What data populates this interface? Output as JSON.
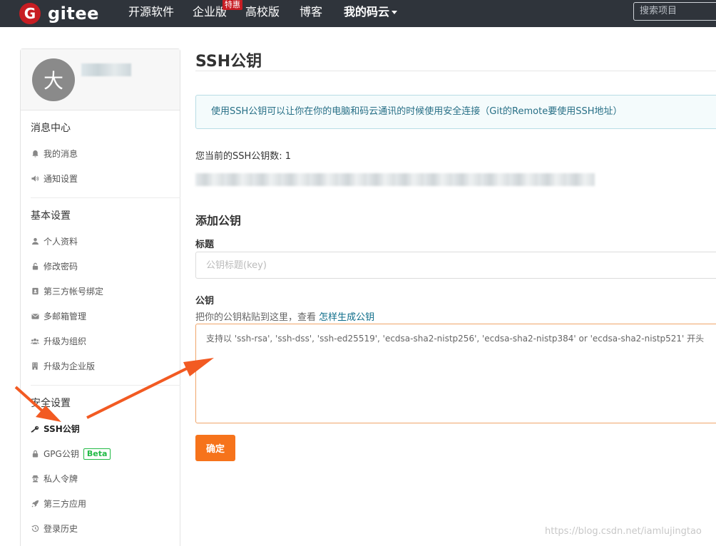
{
  "topnav": {
    "logo_mark": "G",
    "logo_text": "gitee",
    "items": [
      "开源软件",
      "企业版",
      "高校版",
      "博客",
      "我的码云"
    ],
    "hot_badge": "特惠",
    "search_placeholder": "搜索项目"
  },
  "sidebar": {
    "avatar_initial": "大",
    "sections": [
      {
        "title": "消息中心",
        "items": [
          "我的消息",
          "通知设置"
        ]
      },
      {
        "title": "基本设置",
        "items": [
          "个人资料",
          "修改密码",
          "第三方帐号绑定",
          "多邮箱管理",
          "升级为组织",
          "升级为企业版"
        ]
      },
      {
        "title": "安全设置",
        "items": [
          "SSH公钥",
          "GPG公钥",
          "私人令牌",
          "第三方应用",
          "登录历史"
        ]
      }
    ],
    "beta_badge": "Beta",
    "active_item": "SSH公钥"
  },
  "main": {
    "title": "SSH公钥",
    "info": "使用SSH公钥可以让你在你的电脑和码云通讯的时候使用安全连接（Git的Remote要使用SSH地址）",
    "count_text": "您当前的SSH公钥数: 1",
    "add_title": "添加公钥",
    "title_label": "标题",
    "title_placeholder": "公钥标题(key)",
    "key_label": "公钥",
    "key_hint_prefix": "把你的公钥粘贴到这里，查看",
    "key_hint_link": "怎样生成公钥",
    "key_placeholder": "支持以 'ssh-rsa', 'ssh-dss', 'ssh-ed25519', 'ecdsa-sha2-nistp256', 'ecdsa-sha2-nistp384' or 'ecdsa-sha2-nistp521' 开头",
    "submit_label": "确定"
  },
  "watermark": "https://blog.csdn.net/iamlujingtao",
  "colors": {
    "nav_bg": "#2f343b",
    "brand_red": "#c71d23",
    "accent_orange": "#f6731b",
    "annotation_arrow": "#f25a22"
  }
}
